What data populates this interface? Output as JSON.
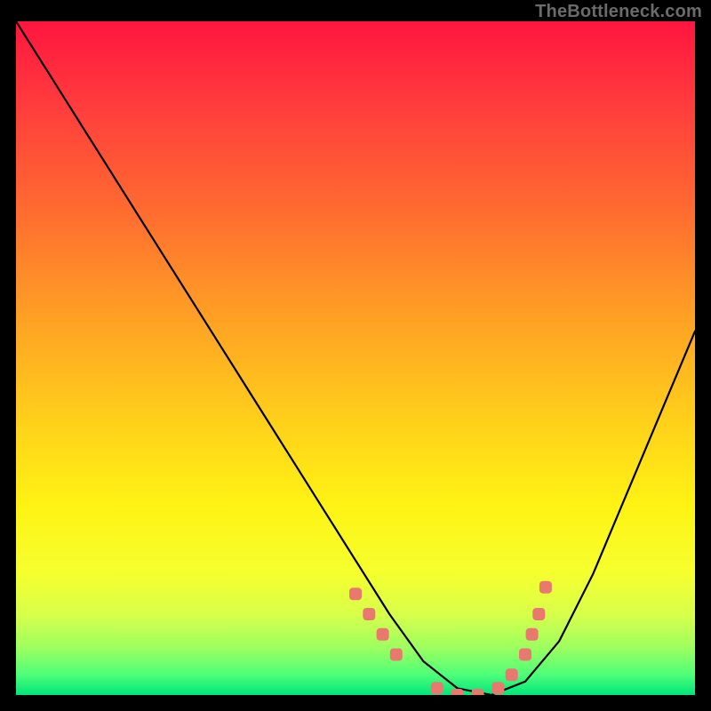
{
  "watermark": "TheBottleneck.com",
  "colors": {
    "background": "#000000",
    "curve": "#000000",
    "marker": "#e9786f",
    "gradient_top": "#ff153f",
    "gradient_bottom": "#00e57a"
  },
  "chart_data": {
    "type": "line",
    "title": "",
    "xlabel": "",
    "ylabel": "",
    "xlim": [
      0,
      100
    ],
    "ylim": [
      0,
      100
    ],
    "series": [
      {
        "name": "bottleneck-curve",
        "x": [
          0,
          5,
          10,
          15,
          20,
          25,
          30,
          35,
          40,
          45,
          50,
          55,
          60,
          65,
          70,
          75,
          80,
          85,
          90,
          95,
          100
        ],
        "y": [
          100,
          92,
          84,
          76,
          68,
          60,
          52,
          44,
          36,
          28,
          20,
          12,
          5,
          1,
          0,
          2,
          8,
          18,
          30,
          42,
          54
        ]
      }
    ],
    "markers": {
      "name": "highlight-dots",
      "x": [
        50,
        52,
        54,
        56,
        62,
        65,
        68,
        71,
        73,
        75,
        76,
        77,
        78
      ],
      "y": [
        15,
        12,
        9,
        6,
        1,
        0,
        0,
        1,
        3,
        6,
        9,
        12,
        16
      ]
    }
  }
}
